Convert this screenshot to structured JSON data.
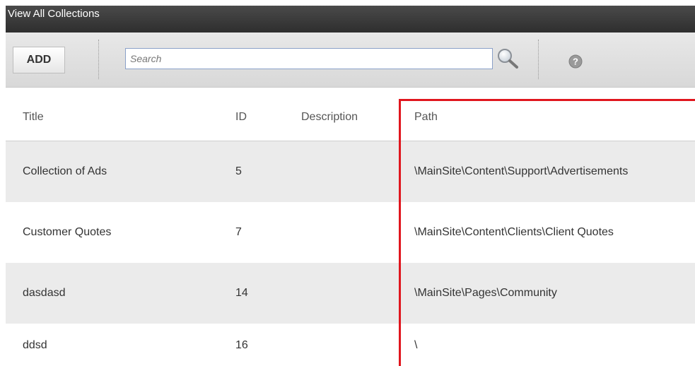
{
  "window": {
    "title": "View All Collections"
  },
  "toolbar": {
    "add_label": "ADD",
    "search_placeholder": "Search",
    "search_value": "",
    "search_icon": "magnifier-icon",
    "help_icon": "help-icon"
  },
  "table": {
    "columns": [
      "Title",
      "ID",
      "Description",
      "Path"
    ],
    "rows": [
      {
        "title": "Collection of Ads",
        "id": "5",
        "description": "",
        "path": "\\MainSite\\Content\\Support\\Advertisements"
      },
      {
        "title": "Customer Quotes",
        "id": "7",
        "description": "",
        "path": "\\MainSite\\Content\\Clients\\Client Quotes"
      },
      {
        "title": "dasdasd",
        "id": "14",
        "description": "",
        "path": "\\MainSite\\Pages\\Community"
      },
      {
        "title": "ddsd",
        "id": "16",
        "description": "",
        "path": "\\"
      }
    ]
  },
  "highlight": {
    "color": "#e0161e",
    "target": "Path column"
  },
  "colors": {
    "titlebar": "#3a3a3a",
    "row_alt": "#ebebeb",
    "search_border": "#8aa0c8"
  }
}
